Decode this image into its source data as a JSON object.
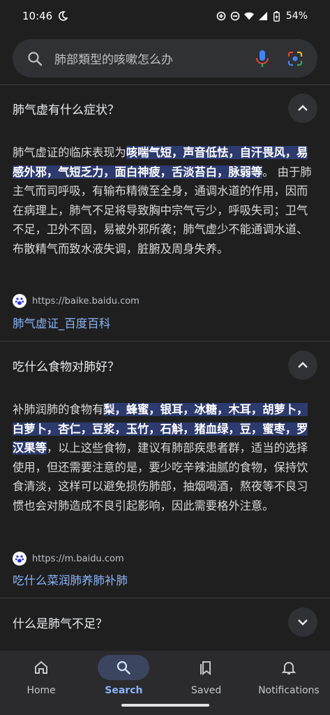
{
  "status": {
    "time": "10:46",
    "battery": "54%"
  },
  "search": {
    "query": "肺部類型的咳嗽怎么办"
  },
  "items": [
    {
      "question": "肺气虚有什么症状？",
      "answer_prefix": "肺气虚证的临床表现为",
      "answer_highlight": "咳喘气短，声音低怯，自汗畏风，易感外邪，气短乏力，面白神疲，舌淡苔白，脉弱等",
      "answer_suffix": "。 由于肺主气而司呼吸，有输布精微至全身，通调水道的作用，因而在病理上，肺气不足将导致胸中宗气亏少，呼吸失司；卫气不足，卫外不固，易被外邪所袭；肺气虚少不能通调水道、布散精气而致水液失调，脏腑及周身失养。",
      "source_url": "https://baike.baidu.com",
      "source_title": "肺气虚证_百度百科"
    },
    {
      "question": "吃什么食物对肺好？",
      "answer_prefix": "补肺润肺的食物有",
      "answer_highlight": "梨，蜂蜜，银耳，冰糖，木耳，胡萝卜，白萝卜，杏仁，豆浆，玉竹，石斛，猪血绿，豆，蜜枣，罗汉果等",
      "answer_suffix": "，以上这些食物，建议有肺部疾患者群，适当的选择使用，但还需要注意的是，要少吃辛辣油腻的食物，保持饮食清淡，这样可以避免损伤肺部，抽烟喝酒，熬夜等不良习惯也会对肺造成不良引起影响，因此需要格外注意。",
      "source_url": "https://m.baidu.com",
      "source_title": "吃什么菜润肺养肺补肺"
    },
    {
      "question": "什么是肺气不足？"
    }
  ],
  "nav": [
    {
      "label": "Home",
      "icon": "home-icon"
    },
    {
      "label": "Search",
      "icon": "search-icon",
      "active": true
    },
    {
      "label": "Saved",
      "icon": "bookmark-icon"
    },
    {
      "label": "Notifications",
      "icon": "bell-icon"
    }
  ]
}
